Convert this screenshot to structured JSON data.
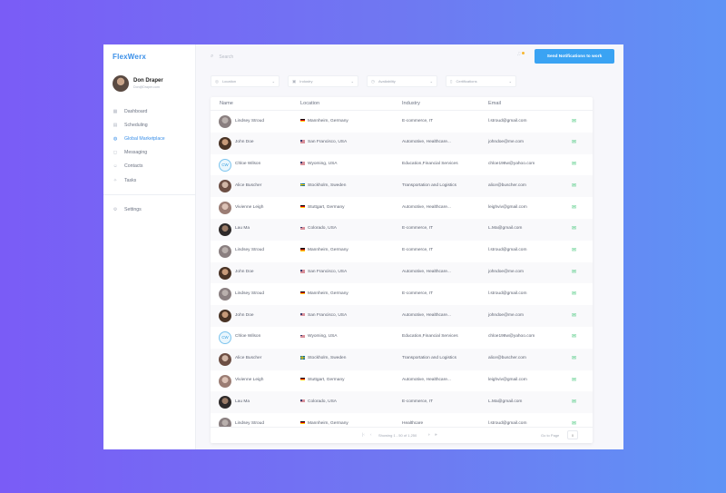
{
  "app": {
    "brand": "FlexWerx"
  },
  "profile": {
    "name": "Don Draper",
    "email": "Don@Draper.com"
  },
  "nav": [
    {
      "label": "Dashboard",
      "icon": "dashboard-icon",
      "glyph": "▦"
    },
    {
      "label": "Scheduling",
      "icon": "calendar-icon",
      "glyph": "▤"
    },
    {
      "label": "Global Marketplace",
      "icon": "globe-icon",
      "glyph": "◍",
      "active": true
    },
    {
      "label": "Messaging",
      "icon": "chat-icon",
      "glyph": "◻"
    },
    {
      "label": "Contacts",
      "icon": "contacts-icon",
      "glyph": "☺"
    },
    {
      "label": "Tasks",
      "icon": "tasks-icon",
      "glyph": "✧"
    }
  ],
  "settings": {
    "label": "Settings",
    "icon": "gear-icon",
    "glyph": "⚙"
  },
  "search": {
    "placeholder": "Search"
  },
  "header": {
    "notify_button": "Send Notifications to work"
  },
  "filters": [
    {
      "label": "Location",
      "icon": "location-icon",
      "glyph": "◎"
    },
    {
      "label": "Industry",
      "icon": "briefcase-icon",
      "glyph": "▣"
    },
    {
      "label": "Availability",
      "icon": "clock-icon",
      "glyph": "◷"
    },
    {
      "label": "Certifications",
      "icon": "certificate-icon",
      "glyph": "▯"
    }
  ],
  "table": {
    "columns": [
      "Name",
      "Location",
      "Industry",
      "Email"
    ],
    "rows": [
      {
        "name": "Lindsey Stroud",
        "avatar": "p1",
        "flag": "de",
        "location": "Mannheim, Germany",
        "industry": "E-commerce, IT",
        "email": "l.stroud@gmail.com"
      },
      {
        "name": "John Doe",
        "avatar": "p2",
        "flag": "us",
        "location": "San Francisco, USA",
        "industry": "Automotive, Healthcare...",
        "email": "johndoe@me.com"
      },
      {
        "name": "Chloe Wilson",
        "avatar": "cw",
        "initials": "CW",
        "flag": "us",
        "location": "Wyoming, USA",
        "industry": "Education,Financial Services",
        "email": "chloe198w@yahoo.com"
      },
      {
        "name": "Alice Buscher",
        "avatar": "p3",
        "flag": "se",
        "location": "Stockholm, Sweden",
        "industry": "Transportation and Logistics",
        "email": "alice@buscher.com"
      },
      {
        "name": "Vivienne Leigh",
        "avatar": "p4",
        "flag": "de",
        "location": "Stuttgart, Germany",
        "industry": "Automotive, Healthcare...",
        "email": "leighviv@gmail.com"
      },
      {
        "name": "Lau Ma",
        "avatar": "p5",
        "flag": "us",
        "location": "Colorado, USA",
        "industry": "E-commerce, IT",
        "email": "L.Ma@gmail.com"
      },
      {
        "name": "Lindsey Stroud",
        "avatar": "p1",
        "flag": "de",
        "location": "Mannheim, Germany",
        "industry": "E-commerce, IT",
        "email": "l.stroud@gmail.com"
      },
      {
        "name": "John Doe",
        "avatar": "p2",
        "flag": "us",
        "location": "San Francisco, USA",
        "industry": "Automotive, Healthcare...",
        "email": "johndoe@me.com"
      },
      {
        "name": "Lindsey Stroud",
        "avatar": "p1",
        "flag": "de",
        "location": "Mannheim, Germany",
        "industry": "E-commerce, IT",
        "email": "l.stroud@gmail.com"
      },
      {
        "name": "John Doe",
        "avatar": "p2",
        "flag": "us",
        "location": "San Francisco, USA",
        "industry": "Automotive, Healthcare...",
        "email": "johndoe@me.com"
      },
      {
        "name": "Chloe Wilson",
        "avatar": "cw",
        "initials": "CW",
        "flag": "us",
        "location": "Wyoming, USA",
        "industry": "Education,Financial Services",
        "email": "chloe198w@yahoo.com"
      },
      {
        "name": "Alice Buscher",
        "avatar": "p3",
        "flag": "se",
        "location": "Stockholm, Sweden",
        "industry": "Transportation and Logistics",
        "email": "alice@buscher.com"
      },
      {
        "name": "Vivienne Leigh",
        "avatar": "p4",
        "flag": "de",
        "location": "Stuttgart, Germany",
        "industry": "Automotive, Healthcare...",
        "email": "leighviv@gmail.com"
      },
      {
        "name": "Lau Ma",
        "avatar": "p5",
        "flag": "us",
        "location": "Colorado, USA",
        "industry": "E-commerce, IT",
        "email": "L.Ma@gmail.com"
      },
      {
        "name": "Lindsey Stroud",
        "avatar": "p1",
        "flag": "de",
        "location": "Mannheim, Germany",
        "industry": "Healthcare",
        "email": "l.stroud@gmail.com"
      }
    ]
  },
  "pager": {
    "first": "|‹",
    "prev": "‹",
    "next": "›",
    "last": "»",
    "status": "Showing 1 - 50 of 1,250",
    "goto_label": "Go to Page",
    "goto_value": "0"
  },
  "colors": {
    "accent": "#3a8fe8",
    "button": "#3aa3f3",
    "mail": "#45c77a"
  }
}
